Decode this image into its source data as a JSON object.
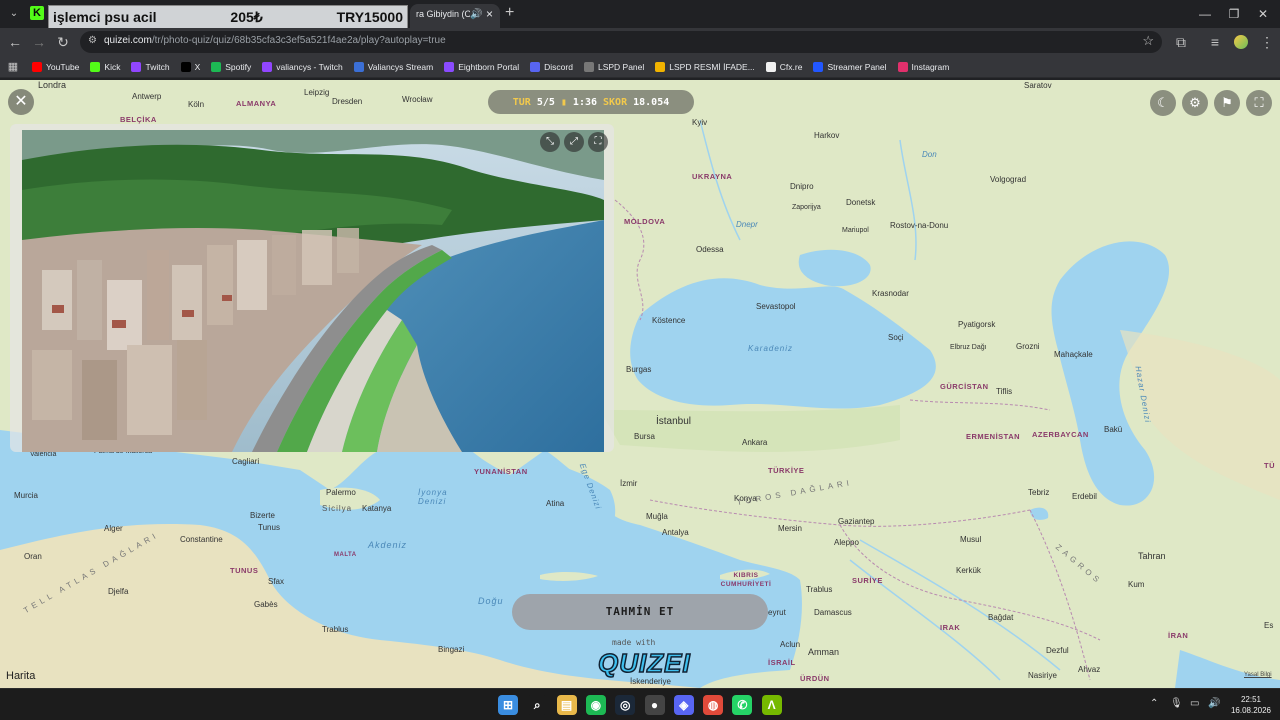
{
  "browser": {
    "ticker": {
      "item": "işlemci psu acil",
      "price_try_symbol": "205₺",
      "price": "TRY15000"
    },
    "active_tab_title": "ra Gibiydin (Offi",
    "url_host": "quizei.com",
    "url_path": "/tr/photo-quiz/quiz/68b35cfa3c3ef5a521f4ae2a/play?autoplay=true",
    "bookmarks": [
      {
        "label": "YouTube",
        "icon": "youtube-icon",
        "color": "#ff0000"
      },
      {
        "label": "Kick",
        "icon": "kick-icon",
        "color": "#53fc18"
      },
      {
        "label": "Twitch",
        "icon": "twitch-icon",
        "color": "#9146ff"
      },
      {
        "label": "X",
        "icon": "x-icon",
        "color": "#000000"
      },
      {
        "label": "Spotify",
        "icon": "spotify-icon",
        "color": "#1db954"
      },
      {
        "label": "valiancys - Twitch",
        "icon": "twitch-icon",
        "color": "#9146ff"
      },
      {
        "label": "Valiancys Stream",
        "icon": "stream-icon",
        "color": "#3b6fd6"
      },
      {
        "label": "Eightborn Portal",
        "icon": "eightborn-icon",
        "color": "#8a4bff"
      },
      {
        "label": "Discord",
        "icon": "discord-icon",
        "color": "#5865f2"
      },
      {
        "label": "LSPD Panel",
        "icon": "lspd-icon",
        "color": "#777777"
      },
      {
        "label": "LSPD  RESMİ İFADE...",
        "icon": "lspd-doc-icon",
        "color": "#f1b300"
      },
      {
        "label": "Cfx.re",
        "icon": "cfx-icon",
        "color": "#f0f0f0"
      },
      {
        "label": "Streamer Panel",
        "icon": "streamer-icon",
        "color": "#2257ff"
      },
      {
        "label": "Instagram",
        "icon": "instagram-icon",
        "color": "#e1306c"
      }
    ]
  },
  "game": {
    "round_label": "TUR",
    "round_value": "5/5",
    "time_value": "1:36",
    "score_label": "SKOR",
    "score_value": "18.054",
    "guess_button": "TAHMİN ET",
    "made_with": "made with",
    "brand": "QUIZEI",
    "map_attribution": "Harita",
    "legal": "Yasal Bilgi"
  },
  "map_labels": {
    "cities": [
      {
        "id": "londra",
        "text": "Londra"
      },
      {
        "id": "antwerp",
        "text": "Antwerp"
      },
      {
        "id": "koln",
        "text": "Köln"
      },
      {
        "id": "leipzig",
        "text": "Leipzig"
      },
      {
        "id": "dresden",
        "text": "Dresden"
      },
      {
        "id": "wroclaw",
        "text": "Wrocław"
      },
      {
        "id": "saratov",
        "text": "Saratov"
      },
      {
        "id": "kyiv",
        "text": "Kyiv"
      },
      {
        "id": "harkov",
        "text": "Harkov"
      },
      {
        "id": "dnipro",
        "text": "Dnipro"
      },
      {
        "id": "zaporijya",
        "text": "Zaporijya"
      },
      {
        "id": "donetsk",
        "text": "Donetsk"
      },
      {
        "id": "volgograd",
        "text": "Volgograd"
      },
      {
        "id": "mariupol",
        "text": "Mariupol"
      },
      {
        "id": "rostov",
        "text": "Rostov-na-Donu"
      },
      {
        "id": "odessa",
        "text": "Odessa"
      },
      {
        "id": "krasnodar",
        "text": "Krasnodar"
      },
      {
        "id": "sevastopol",
        "text": "Sevastopol"
      },
      {
        "id": "pyatigorsk",
        "text": "Pyatigorsk"
      },
      {
        "id": "soci",
        "text": "Soçi"
      },
      {
        "id": "elbruz",
        "text": "Elbruz Dağı"
      },
      {
        "id": "grozni",
        "text": "Grozni"
      },
      {
        "id": "mahackale",
        "text": "Mahaçkale"
      },
      {
        "id": "kostence",
        "text": "Köstence"
      },
      {
        "id": "burgas",
        "text": "Burgas"
      },
      {
        "id": "istanbul",
        "text": "İstanbul"
      },
      {
        "id": "bursa",
        "text": "Bursa"
      },
      {
        "id": "ankara",
        "text": "Ankara"
      },
      {
        "id": "tiflis",
        "text": "Tiflis"
      },
      {
        "id": "baku",
        "text": "Bakü"
      },
      {
        "id": "valencia",
        "text": "Valencia"
      },
      {
        "id": "palma",
        "text": "Palma de Mallorca"
      },
      {
        "id": "cagliari",
        "text": "Cagliari"
      },
      {
        "id": "izmir",
        "text": "İzmir"
      },
      {
        "id": "konya",
        "text": "Konya"
      },
      {
        "id": "tebriz",
        "text": "Tebriz"
      },
      {
        "id": "erdebil",
        "text": "Erdebil"
      },
      {
        "id": "murcia",
        "text": "Murcia"
      },
      {
        "id": "palermo",
        "text": "Palermo"
      },
      {
        "id": "bizerte",
        "text": "Bizerte"
      },
      {
        "id": "tunus_c",
        "text": "Tunus"
      },
      {
        "id": "atina",
        "text": "Atina"
      },
      {
        "id": "mugla",
        "text": "Muğla"
      },
      {
        "id": "katanya",
        "text": "Katanya"
      },
      {
        "id": "mersin",
        "text": "Mersin"
      },
      {
        "id": "gaziantep",
        "text": "Gaziantep"
      },
      {
        "id": "antalya",
        "text": "Antalya"
      },
      {
        "id": "aleppo",
        "text": "Aleppo"
      },
      {
        "id": "musul",
        "text": "Musul"
      },
      {
        "id": "cezayir",
        "text": "Alger"
      },
      {
        "id": "constantine",
        "text": "Constantine"
      },
      {
        "id": "tahran",
        "text": "Tahran"
      },
      {
        "id": "oran",
        "text": "Oran"
      },
      {
        "id": "kerkuk",
        "text": "Kerkük"
      },
      {
        "id": "kum",
        "text": "Kum"
      },
      {
        "id": "sfax",
        "text": "Sfax"
      },
      {
        "id": "trablus_l",
        "text": "Trablus"
      },
      {
        "id": "djelfa",
        "text": "Djelfa"
      },
      {
        "id": "gabes",
        "text": "Gabès"
      },
      {
        "id": "beyrut",
        "text": "eyrut"
      },
      {
        "id": "damascus",
        "text": "Damascus"
      },
      {
        "id": "bagdat",
        "text": "Bağdat"
      },
      {
        "id": "trablus_t",
        "text": "Trablus"
      },
      {
        "id": "aclun",
        "text": "Aclun"
      },
      {
        "id": "amman",
        "text": "Amman"
      },
      {
        "id": "dezful",
        "text": "Dezful"
      },
      {
        "id": "bingazi",
        "text": "Bingazi"
      },
      {
        "id": "iskenderiye",
        "text": "İskenderiye"
      },
      {
        "id": "nasiriye",
        "text": "Nasiriye"
      },
      {
        "id": "ahvaz",
        "text": "Ahvaz"
      },
      {
        "id": "esfa",
        "text": "Es"
      },
      {
        "id": "don",
        "text": "Don"
      },
      {
        "id": "dnepr",
        "text": "Dnepr"
      }
    ],
    "countries": [
      {
        "id": "almanya",
        "text": "ALMANYA"
      },
      {
        "id": "belcika",
        "text": "BELÇİKA"
      },
      {
        "id": "ukrayna",
        "text": "UKRAYNA"
      },
      {
        "id": "moldova",
        "text": "MOLDOVA"
      },
      {
        "id": "gurcistan",
        "text": "GÜRCİSTAN"
      },
      {
        "id": "ermenistan",
        "text": "ERMENİSTAN"
      },
      {
        "id": "azerbaycan",
        "text": "AZERBAYCAN"
      },
      {
        "id": "turkiye",
        "text": "TÜRKİYE"
      },
      {
        "id": "yunanistan",
        "text": "YUNANİSTAN"
      },
      {
        "id": "tunus",
        "text": "TUNUS"
      },
      {
        "id": "malta",
        "text": "MALTA"
      },
      {
        "id": "kibris",
        "text": "KIBRIS CUMHURİYETİ"
      },
      {
        "id": "suriye",
        "text": "SURİYE"
      },
      {
        "id": "irak",
        "text": "IRAK"
      },
      {
        "id": "iran",
        "text": "İRAN"
      },
      {
        "id": "israil",
        "text": "İSRAİL"
      },
      {
        "id": "urdun",
        "text": "ÜRDÜN"
      },
      {
        "id": "tur_edge",
        "text": "TÜ"
      }
    ],
    "seas": [
      {
        "id": "karadeniz",
        "text": "Karadeniz"
      },
      {
        "id": "iyonya",
        "text": "İyonya Denizi"
      },
      {
        "id": "akdeniz",
        "text": "Akdeniz"
      },
      {
        "id": "ege",
        "text": "Ege Denizi"
      },
      {
        "id": "sicilya",
        "text": "Sicilya"
      },
      {
        "id": "toros",
        "text": "TOROS DAĞLARI"
      },
      {
        "id": "atlas",
        "text": "TELL ATLAS DAĞLARI"
      },
      {
        "id": "hazar",
        "text": "Hazar Denizi"
      },
      {
        "id": "zagros",
        "text": "ZAGROS"
      },
      {
        "id": "dogu",
        "text": "Doğu"
      },
      {
        "id": "don_r",
        "text": "Don"
      }
    ]
  },
  "taskbar": {
    "apps": [
      {
        "icon": "windows-start-icon"
      },
      {
        "icon": "search-icon"
      },
      {
        "icon": "file-explorer-icon"
      },
      {
        "icon": "spotify-icon"
      },
      {
        "icon": "steam-icon"
      },
      {
        "icon": "obs-icon"
      },
      {
        "icon": "discord-icon"
      },
      {
        "icon": "chrome-icon"
      },
      {
        "icon": "whatsapp-icon"
      },
      {
        "icon": "nvidia-icon"
      }
    ],
    "time": "22:51",
    "date": "16.08.2026"
  }
}
